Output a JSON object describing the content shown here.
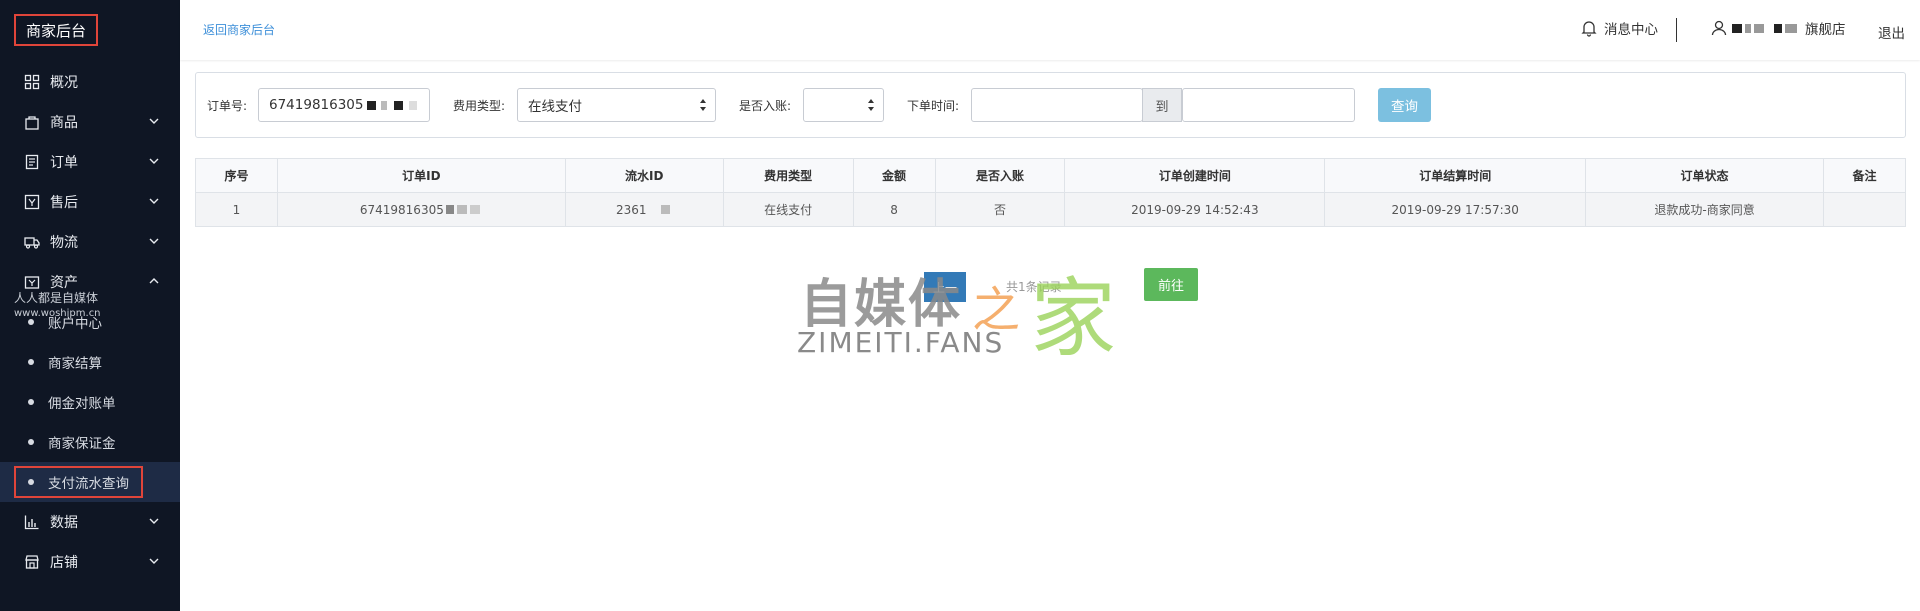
{
  "sidebar": {
    "logo": "商家后台",
    "items": [
      {
        "label": "概况",
        "icon": "grid-icon"
      },
      {
        "label": "商品",
        "icon": "bag-icon"
      },
      {
        "label": "订单",
        "icon": "order-icon"
      },
      {
        "label": "售后",
        "icon": "aftersale-icon"
      },
      {
        "label": "物流",
        "icon": "truck-icon"
      },
      {
        "label": "资产",
        "icon": "asset-icon"
      }
    ],
    "sub_items": [
      "账户中心",
      "商家结算",
      "佣金对账单",
      "商家保证金",
      "支付流水查询"
    ],
    "bottom_items": [
      {
        "label": "数据",
        "icon": "chart-icon"
      },
      {
        "label": "店铺",
        "icon": "store-icon"
      }
    ],
    "watermark_line1": "人人都是自媒体",
    "watermark_line2": "www.woshipm.cn"
  },
  "header": {
    "back_link": "返回商家后台",
    "messages": "消息中心",
    "shop_name": "旗舰店",
    "logout": "退出"
  },
  "filter": {
    "order_no_label": "订单号:",
    "order_no_value": "67419816305",
    "fee_type_label": "费用类型:",
    "fee_type_value": "在线支付",
    "settled_label": "是否入账:",
    "settled_value": "",
    "time_label": "下单时间:",
    "to": "到",
    "query_button": "查询"
  },
  "table": {
    "headers": [
      "序号",
      "订单ID",
      "流水ID",
      "费用类型",
      "金额",
      "是否入账",
      "订单创建时间",
      "订单结算时间",
      "订单状态",
      "备注"
    ],
    "rows": [
      [
        "1",
        "67419816305",
        "2361",
        "在线支付",
        "8",
        "否",
        "2019-09-29 14:52:43",
        "2019-09-29 17:57:30",
        "退款成功-商家同意",
        ""
      ]
    ]
  },
  "pager": {
    "prev": "上一",
    "total": "共1条记录",
    "go": "前往"
  },
  "watermark": {
    "cn": "自媒体",
    "zhi": "之",
    "jia": "家",
    "en": "ZIMEITI.FANS"
  }
}
